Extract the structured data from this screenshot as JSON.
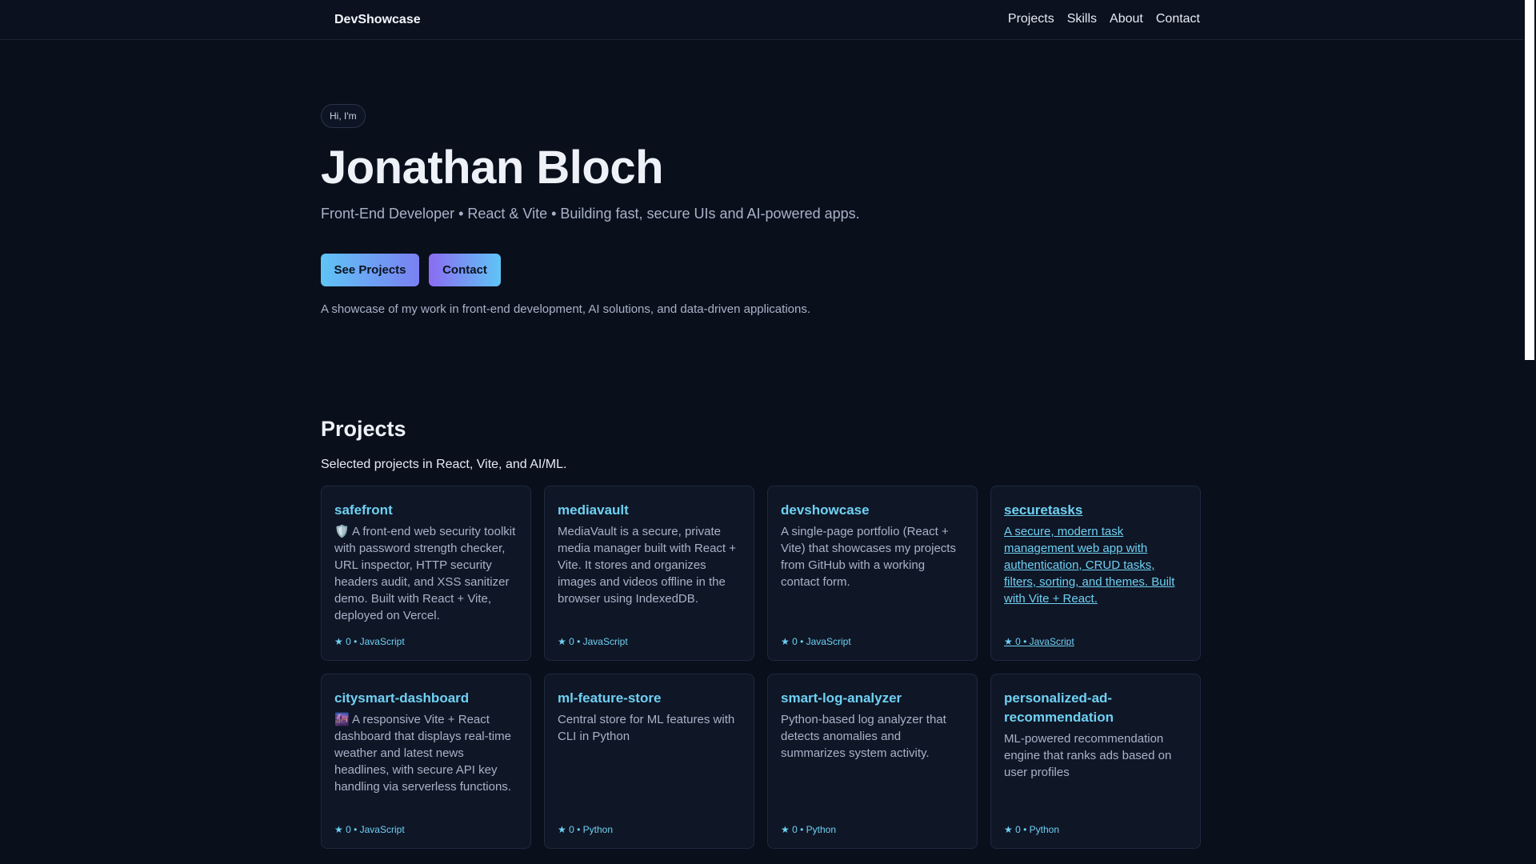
{
  "nav": {
    "brand": "DevShowcase",
    "links": [
      "Projects",
      "Skills",
      "About",
      "Contact"
    ]
  },
  "scroll_progress": 0.16,
  "hero": {
    "badge": "Hi, I'm",
    "name": "Jonathan Bloch",
    "tagline": "Front-End Developer • React & Vite • Building fast, secure UIs and AI-powered apps.",
    "primary_button": "See Projects",
    "secondary_button": "Contact",
    "intro": "A showcase of my work in front-end development, AI solutions, and data-driven applications."
  },
  "projects": {
    "title": "Projects",
    "subtitle": "Selected projects in React, Vite, and AI/ML.",
    "items": [
      {
        "name": "safefront",
        "desc": "🛡️ A front-end web security toolkit with password strength checker, URL inspector, HTTP security headers audit, and XSS sanitizer demo. Built with React + Vite, deployed on Vercel.",
        "meta": "★ 0 • JavaScript"
      },
      {
        "name": "mediavault",
        "desc": "MediaVault is a secure, private media manager built with React + Vite. It stores and organizes images and videos offline in the browser using IndexedDB.",
        "meta": "★ 0 • JavaScript"
      },
      {
        "name": "devshowcase",
        "desc": "A single-page portfolio (React + Vite) that showcases my projects from GitHub with a working contact form.",
        "meta": "★ 0 • JavaScript"
      },
      {
        "name": "securetasks",
        "desc": "A secure, modern task management web app with authentication, CRUD tasks, filters, sorting, and themes. Built with Vite + React.",
        "meta": "★ 0 • JavaScript"
      },
      {
        "name": "citysmart-dashboard",
        "desc": "🌆 A responsive Vite + React dashboard that displays real-time weather and latest news headlines, with secure API key handling via serverless functions.",
        "meta": "★ 0 • JavaScript"
      },
      {
        "name": "ml-feature-store",
        "desc": "Central store for ML features with CLI in Python",
        "meta": "★ 0 • Python"
      },
      {
        "name": "smart-log-analyzer",
        "desc": "Python-based log analyzer that detects anomalies and summarizes system activity.",
        "meta": "★ 0 • Python"
      },
      {
        "name": "personalized-ad-recommendation",
        "desc": "ML-powered recommendation engine that ranks ads based on user profiles",
        "meta": "★ 0 • Python"
      }
    ]
  }
}
